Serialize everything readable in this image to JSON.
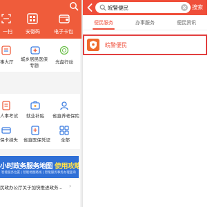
{
  "left": {
    "header": {
      "scan_label": "一扫",
      "anquan_label": "安徽码",
      "card_label": "电子卡包"
    },
    "grid1": [
      {
        "label": "事大厅"
      },
      {
        "label": "城乡居民医保\n专题"
      },
      {
        "label": "光盘行动"
      }
    ],
    "grid2": [
      {
        "label": "人事考试"
      },
      {
        "label": "就业补贴"
      },
      {
        "label": "省直养老保险"
      },
      {
        "label": "保卡挂失"
      },
      {
        "label": "省直医保凭证"
      },
      {
        "label": "全部"
      }
    ],
    "banner": {
      "text_a": "小时",
      "text_b": "政务服务地图",
      "text_c": "使用攻略",
      "sub": "智能服务位置 | 智能地图路线 | 智能服务事务办理查询"
    },
    "news": {
      "text": "民政办公厅关于加快推进政务..."
    }
  },
  "right": {
    "search": {
      "value": "皖警便民",
      "button_label": "搜索"
    },
    "tabs": [
      {
        "label": "便民服务",
        "active": true
      },
      {
        "label": "办事服务",
        "active": false
      },
      {
        "label": "便民资讯",
        "active": false
      }
    ],
    "result": {
      "label": "皖警便民"
    }
  },
  "colors": {
    "header_red": "#ef4e3a",
    "left_header_orange": "#ef5c3b",
    "highlight_border": "#e23e3e",
    "banner_blue": "#2f6fd6"
  }
}
